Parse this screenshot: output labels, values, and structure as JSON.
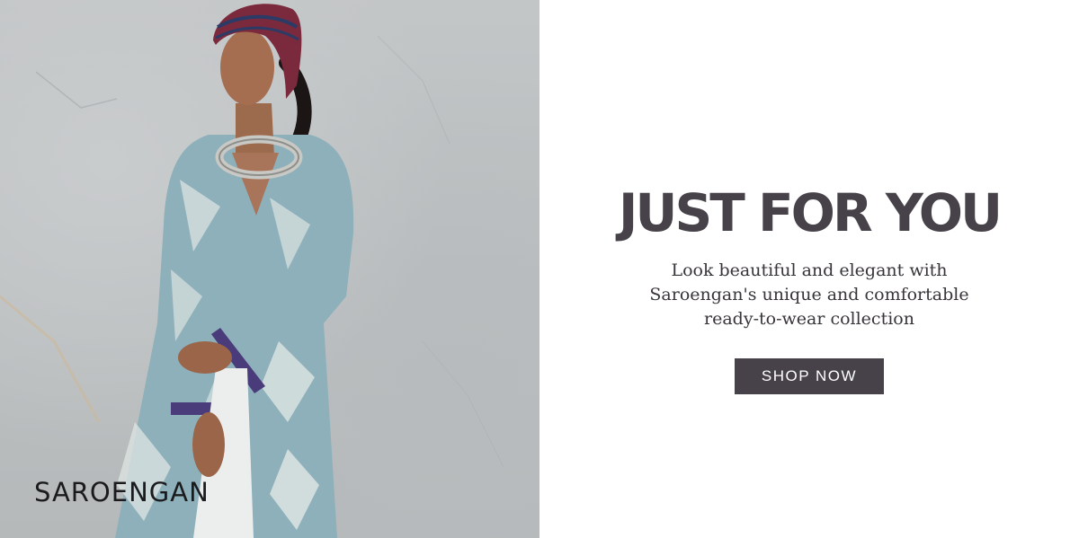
{
  "hero": {
    "logo_text": "SAROENGAN",
    "headline": "JUST FOR YOU",
    "subtext": [
      "Look beautiful and elegant with",
      "Saroengan's unique and comfortable",
      "ready-to-wear collection"
    ],
    "cta_label": "SHOP NOW"
  },
  "colors": {
    "text_dark": "#47424a",
    "button_bg": "#47424a",
    "button_text": "#ffffff",
    "garment_teal": "#7fa6b2",
    "headwrap_maroon": "#7a2a3c"
  }
}
